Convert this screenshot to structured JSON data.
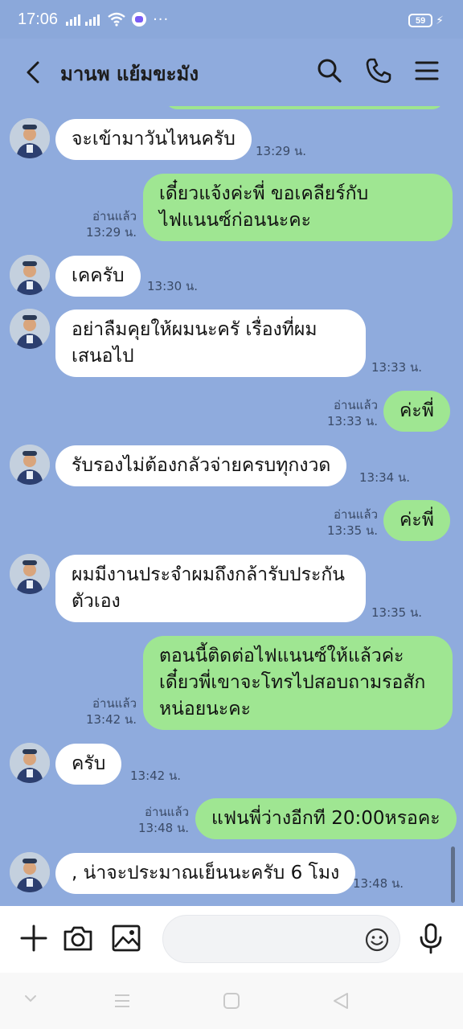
{
  "status": {
    "time": "17:06",
    "battery": "59",
    "more": "···"
  },
  "header": {
    "contact_name": "มานพ แย้มขะมัง"
  },
  "messages": [
    {
      "dir": "in",
      "text": "จะเข้ามาวันไหนครับ",
      "time": "13:29 น."
    },
    {
      "dir": "out",
      "text": "เดี๋ยวแจ้งค่ะพี่ ขอเคลียร์กับ\nไฟแนนซ์ก่อนนะคะ",
      "read": "อ่านแล้ว",
      "time": "13:29 น."
    },
    {
      "dir": "in",
      "text": "เคครับ",
      "time": "13:30 น."
    },
    {
      "dir": "in",
      "text": "อย่าลืมคุยให้ผมนะครั เรื่องที่ผม\nเสนอไป",
      "time": "13:33 น."
    },
    {
      "dir": "out",
      "text": "ค่ะพี่",
      "read": "อ่านแล้ว",
      "time": "13:33 น."
    },
    {
      "dir": "in",
      "text": "รับรองไม่ต้องกลัวจ่ายครบทุกงวด",
      "time": "13:34 น."
    },
    {
      "dir": "out",
      "text": "ค่ะพี่",
      "read": "อ่านแล้ว",
      "time": "13:35 น."
    },
    {
      "dir": "in",
      "text": "ผมมีงานประจำผมถึงกล้ารับประกัน\nตัวเอง",
      "time": "13:35 น."
    },
    {
      "dir": "out",
      "text": "ตอนนี้ติดต่อไฟแนนซ์ให้แล้วค่ะ\nเดี๋ยวพี่เขาจะโทรไปสอบถามรอสัก\nหน่อยนะคะ",
      "read": "อ่านแล้ว",
      "time": "13:42 น."
    },
    {
      "dir": "in",
      "text": "ครับ",
      "time": "13:42 น."
    },
    {
      "dir": "out",
      "text": "แฟนพี่ว่างอีกที 20:00หรอคะ",
      "read": "อ่านแล้ว",
      "time": "13:48 น."
    },
    {
      "dir": "in",
      "text": ", น่าจะประมาณเย็นนะครับ 6 โมง",
      "time": "13:48 น."
    }
  ],
  "input": {
    "placeholder": ""
  },
  "icons": {
    "back": "chevron-left-icon",
    "search": "search-icon",
    "call": "phone-icon",
    "menu": "menu-icon",
    "add": "plus-icon",
    "camera": "camera-icon",
    "image": "image-icon",
    "emoji": "smiley-icon",
    "mic": "microphone-icon"
  },
  "colors": {
    "background": "#8fabdd",
    "incoming_bubble": "#ffffff",
    "outgoing_bubble": "#9fe692"
  }
}
